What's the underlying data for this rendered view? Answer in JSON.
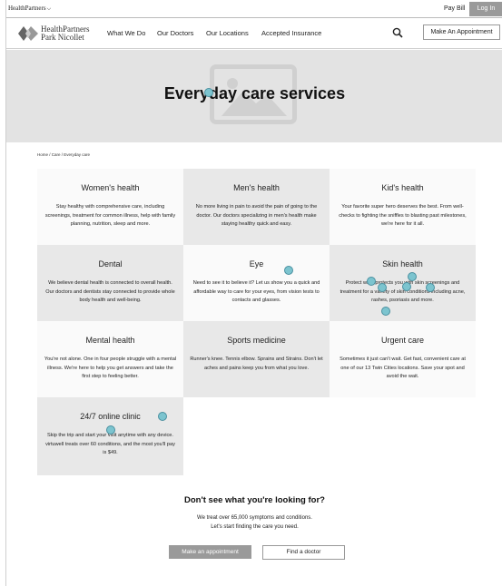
{
  "utility": {
    "brand": "HealthPartners",
    "pay_bill": "Pay Bill",
    "log_in": "Log In"
  },
  "nav": {
    "logo_line1": "HealthPartners",
    "logo_line2": "Park Nicollet",
    "links": [
      "What We Do",
      "Our Doctors",
      "Our Locations",
      "Accepted Insurance"
    ],
    "appointment": "Make An Appointment"
  },
  "hero": {
    "title": "Everyday care services"
  },
  "breadcrumb": "Home / Care / Everyday care",
  "cards": [
    {
      "title": "Women's health",
      "text": "Stay healthy with comprehensive care, including screenings, treatment for common illness, help with family planning, nutrition, sleep and more."
    },
    {
      "title": "Men's health",
      "text": "No more living in pain to avoid the pain of going to the doctor. Our doctors specializing in men's health make staying healthy quick and easy."
    },
    {
      "title": "Kid's health",
      "text": "Your favorite super hero deserves the best. From well-checks to fighting the sniffles to blasting past milestones, we're here for it all."
    },
    {
      "title": "Dental",
      "text": "We believe dental health is connected to overall health. Our doctors and dentists stay connected to provide whole body health and well-being."
    },
    {
      "title": "Eye",
      "text": "Need to see it to believe it? Let us show you a quick and affordable way to care for your eyes, from vision tests to contacts and glasses."
    },
    {
      "title": "Skin health",
      "text": "Protect what protects you with skin screenings and treatment for a variety of skin conditions including acne, rashes, psoriasis and more."
    },
    {
      "title": "Mental health",
      "text": "You're not alone. One in four people struggle with a mental illness. We're here to help you get answers and take the first step to feeling better."
    },
    {
      "title": "Sports medicine",
      "text": "Runner's knee. Tennis elbow. Sprains and Strains. Don't let aches and pains keep you from what you love."
    },
    {
      "title": "Urgent care",
      "text": "Sometimes it just can't wait. Get fast, convenient care at one of our 13 Twin Cities locations. Save your spot and avoid the wait."
    },
    {
      "title": "24/7 online clinic",
      "text": "Skip the trip and start your visit anytime with any device. virtuwell treats over 60 conditions, and the most you'll pay is $49."
    }
  ],
  "cta": {
    "title": "Don't see what you're looking for?",
    "line1": "We treat over 65,000 symptoms and conditions.",
    "line2": "Let's start finding the care you need.",
    "appointment": "Make an appointment",
    "find_doctor": "Find a doctor"
  },
  "colors": {
    "hero_bg": "#e3e3e3",
    "card_gray": "#e8e8e8",
    "button_gray": "#9a9a9a",
    "marker": "#7cc4cf"
  }
}
